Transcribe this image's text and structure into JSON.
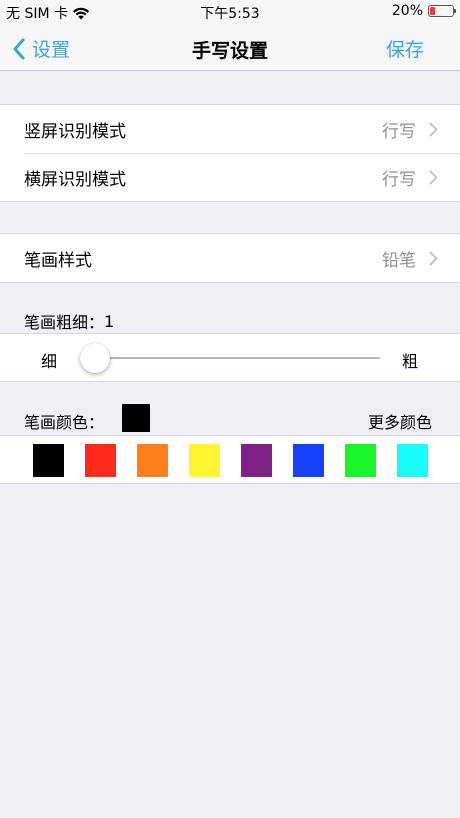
{
  "status_bar": {
    "carrier": "无 SIM 卡",
    "time": "下午5:53",
    "battery_percent": "20%",
    "battery_level": 0.2,
    "icons": [
      "wifi-icon",
      "battery-icon"
    ]
  },
  "nav": {
    "back_label": "设置",
    "title": "手写设置",
    "save_label": "保存",
    "accent_color": "#3aa6d8"
  },
  "recognition": [
    {
      "label": "竖屏识别模式",
      "value": "行写"
    },
    {
      "label": "横屏识别模式",
      "value": "行写"
    }
  ],
  "stroke_style": {
    "label": "笔画样式",
    "value": "铅笔"
  },
  "stroke_width": {
    "label": "笔画粗细：",
    "value": "1",
    "min_label": "细",
    "max_label": "粗",
    "slider_fraction": 0.05
  },
  "stroke_color": {
    "label": "笔画颜色：",
    "current": "#000000",
    "more_label": "更多颜色",
    "palette": [
      {
        "name": "black",
        "hex": "#000000"
      },
      {
        "name": "red",
        "hex": "#ff2a1b"
      },
      {
        "name": "orange",
        "hex": "#ff7f1c"
      },
      {
        "name": "yellow",
        "hex": "#fdf530"
      },
      {
        "name": "purple",
        "hex": "#7e2184"
      },
      {
        "name": "blue",
        "hex": "#1443fb"
      },
      {
        "name": "green",
        "hex": "#18f52b"
      },
      {
        "name": "cyan",
        "hex": "#18fcfb"
      }
    ]
  }
}
